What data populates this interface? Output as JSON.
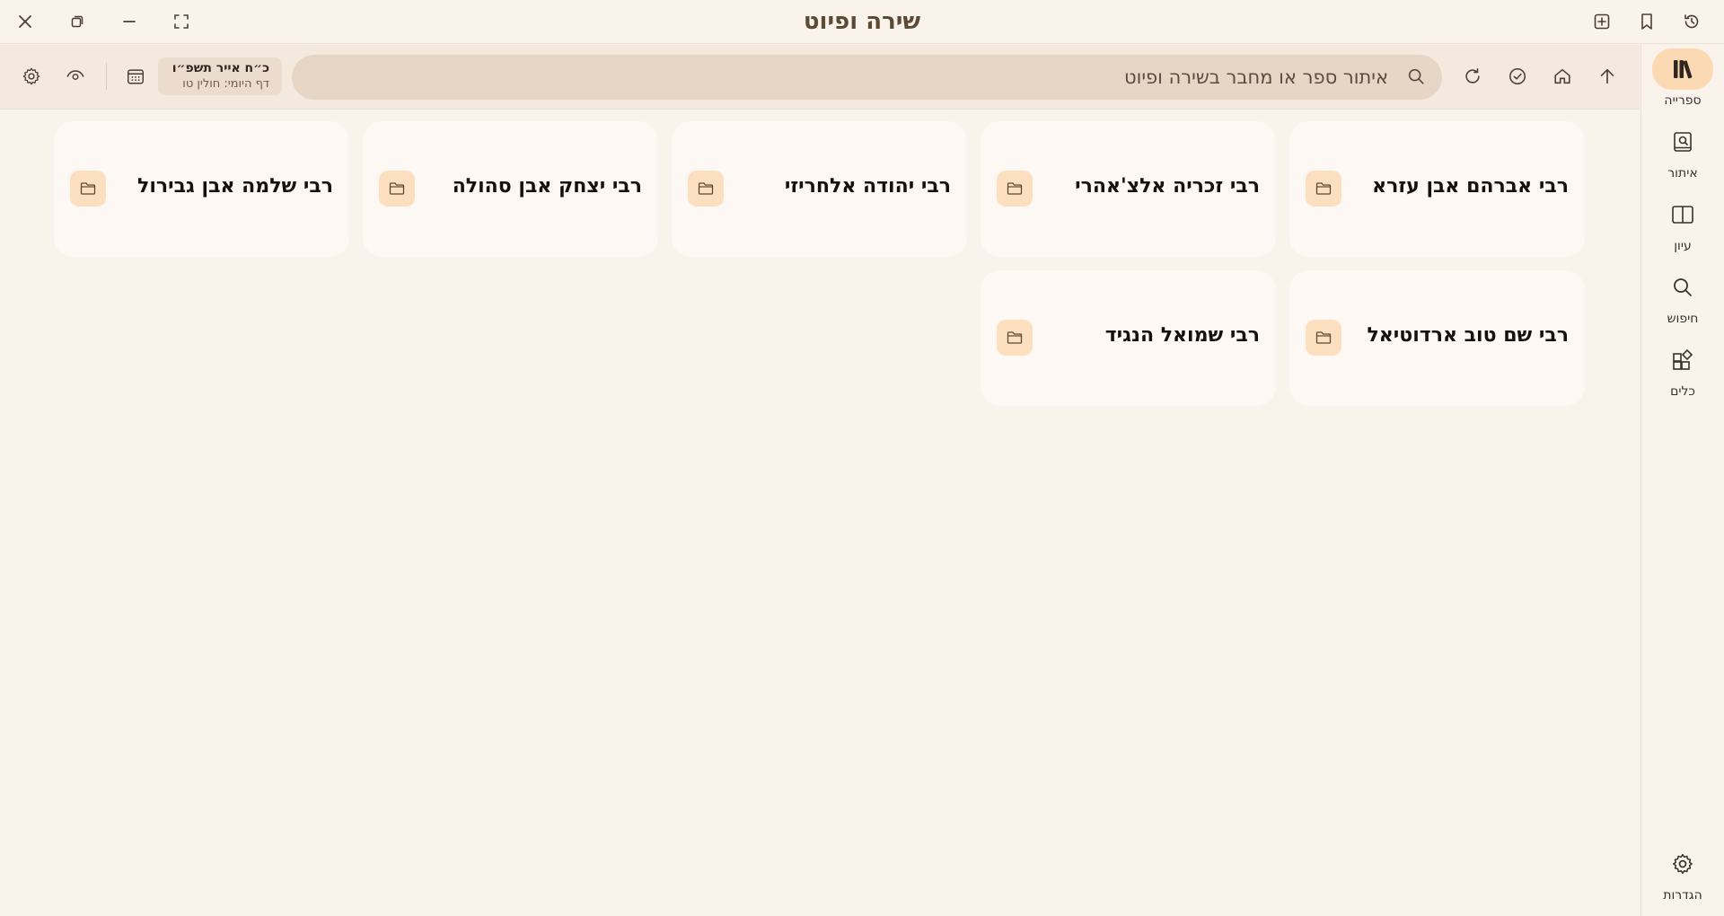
{
  "window": {
    "title": "שירה ופיוט"
  },
  "toolbar": {
    "search_placeholder": "איתור ספר או מחבר בשירה ופיוט",
    "date_main": "כ״ח אייר תשפ״ו",
    "date_sub": "דף היומי: חולין טו"
  },
  "rail": {
    "items": [
      {
        "label": "ספרייה",
        "icon": "library-icon",
        "active": true
      },
      {
        "label": "איתור",
        "icon": "find-book-icon"
      },
      {
        "label": "עיון",
        "icon": "open-book-icon"
      },
      {
        "label": "חיפוש",
        "icon": "search-icon"
      },
      {
        "label": "כלים",
        "icon": "tools-icon"
      }
    ],
    "settings_label": "הגדרות"
  },
  "cards": [
    {
      "title": "רבי אברהם אבן עזרא",
      "icon": "folder-icon"
    },
    {
      "title": "רבי זכריה אלצ'אהרי",
      "icon": "folder-icon"
    },
    {
      "title": "רבי יהודה אלחריזי",
      "icon": "folder-icon"
    },
    {
      "title": "רבי יצחק אבן סהולה",
      "icon": "folder-icon"
    },
    {
      "title": "רבי שלמה אבן גבירול",
      "icon": "folder-icon"
    },
    {
      "title": "רבי שם טוב ארדוטיאל",
      "icon": "folder-icon"
    },
    {
      "title": "רבי שמואל הנגיד",
      "icon": "folder-icon"
    }
  ],
  "colors": {
    "background": "#faf3ec",
    "toolbar": "#f3e9df",
    "search_fill": "#e7d6c5",
    "accent": "#fbd9b3",
    "card": "#fef8f4"
  }
}
